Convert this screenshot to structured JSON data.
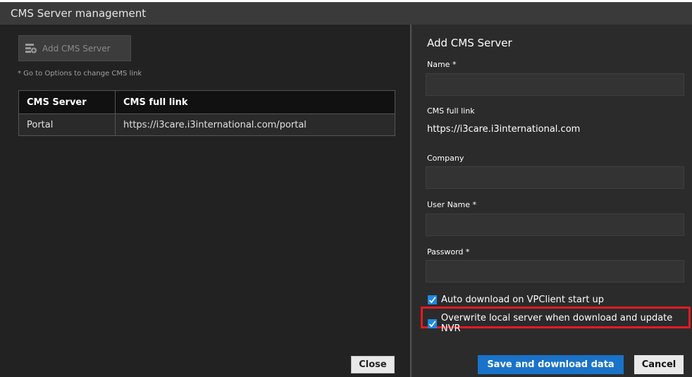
{
  "window": {
    "title": "CMS Server management"
  },
  "left": {
    "add_button": "Add CMS Server",
    "hint": "* Go to Options to change CMS link",
    "table": {
      "headers": [
        "CMS Server",
        "CMS full link"
      ],
      "rows": [
        {
          "server": "Portal",
          "link": "https://i3care.i3international.com/portal"
        }
      ]
    },
    "close_button": "Close"
  },
  "form": {
    "title": "Add CMS Server",
    "name_label": "Name *",
    "name_value": "",
    "cms_link_label": "CMS full link",
    "cms_link_value": "https://i3care.i3international.com",
    "company_label": "Company",
    "company_value": "",
    "username_label": "User Name *",
    "username_value": "",
    "password_label": "Password *",
    "password_value": "",
    "auto_download_label": "Auto download on VPClient start up",
    "auto_download_checked": true,
    "overwrite_label": "Overwrite local server when download and update NVR",
    "overwrite_checked": true,
    "save_button": "Save and download data",
    "cancel_button": "Cancel"
  },
  "colors": {
    "accent": "#1a73c8",
    "checkbox": "#1e88e5",
    "highlight": "#e31b23"
  }
}
